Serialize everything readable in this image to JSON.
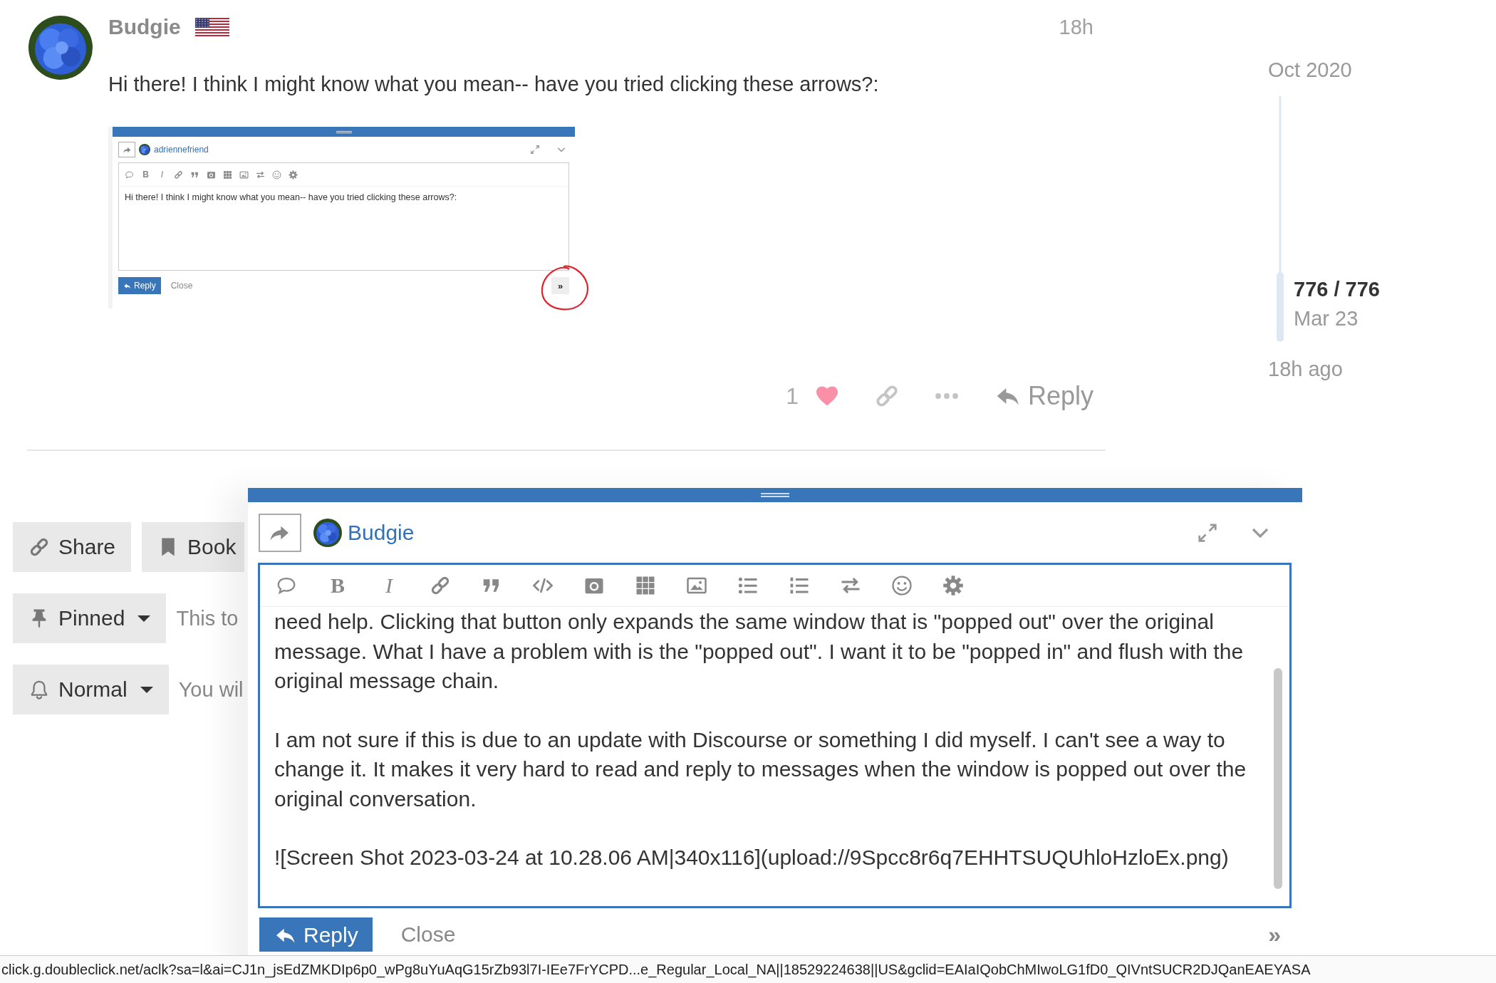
{
  "post": {
    "author": "Budgie",
    "time": "18h",
    "text": "Hi there! I think I might know what you mean-- have you tried clicking these arrows?:",
    "screenshot": {
      "author": "adriennefriend",
      "toolbar": [
        {
          "kind": "quote"
        },
        {
          "kind": "bold",
          "glyph": "B"
        },
        {
          "kind": "italic",
          "glyph": "I"
        },
        {
          "kind": "link"
        },
        {
          "kind": "blockquote"
        },
        {
          "kind": "camera"
        },
        {
          "kind": "grid"
        },
        {
          "kind": "image"
        },
        {
          "kind": "swap"
        },
        {
          "kind": "emoji"
        },
        {
          "kind": "gear"
        }
      ],
      "text": "Hi there! I think I might know what you mean-- have you tried clicking these arrows?:",
      "reply": "Reply",
      "close": "Close",
      "toggle": "»"
    },
    "likes": "1",
    "reply": "Reply"
  },
  "timeline": {
    "start": "Oct 2020",
    "position": "776 / 776",
    "date": "Mar 23",
    "end": "18h ago"
  },
  "topic_footer": {
    "buttons": [
      {
        "kind": "share",
        "label": "Share"
      },
      {
        "kind": "bookmark",
        "label": "Book"
      }
    ],
    "controls": [
      {
        "kind": "pin",
        "label": "Pinned",
        "description": "This to"
      },
      {
        "kind": "notifications",
        "label": "Normal",
        "description": "You wil"
      }
    ]
  },
  "composer": {
    "author": "Budgie",
    "toolbar": [
      {
        "kind": "quote"
      },
      {
        "kind": "bold",
        "glyph": "B"
      },
      {
        "kind": "italic",
        "glyph": "I"
      },
      {
        "kind": "link"
      },
      {
        "kind": "blockquote"
      },
      {
        "kind": "code"
      },
      {
        "kind": "camera"
      },
      {
        "kind": "grid"
      },
      {
        "kind": "image"
      },
      {
        "kind": "bullets"
      },
      {
        "kind": "numbers"
      },
      {
        "kind": "swap"
      },
      {
        "kind": "emoji"
      },
      {
        "kind": "gear"
      }
    ],
    "paragraphs": [
      "need help. Clicking that button only expands the same window that is \"popped out\" over the original message. What I have a problem with is the \"popped out\". I want it to be \"popped in\" and flush with the original message chain.",
      "I am not sure if this is due to an update with Discourse or something I did myself. I can't see a way to change it. It makes it very hard to read and reply to messages when the window is popped out over the original conversation.",
      "![Screen Shot 2023-03-24 at 10.28.06 AM|340x116](upload://9Spcc8r6q7EHHTSUQUhloHzloEx.png)"
    ],
    "reply": "Reply",
    "close": "Close",
    "toggle": "»"
  },
  "status_bar": {
    "url": "click.g.doubleclick.net/aclk?sa=l&ai=CJ1n_jsEdZMKDIp6p0_wPg8uYuAqG15rZb93l7I-IEe7FrYCPD...e_Regular_Local_NA||18529224638||US&gclid=EAIaIQobChMIwoLG1fD0_QIVntSUCR2DJQanEAEYASA"
  }
}
